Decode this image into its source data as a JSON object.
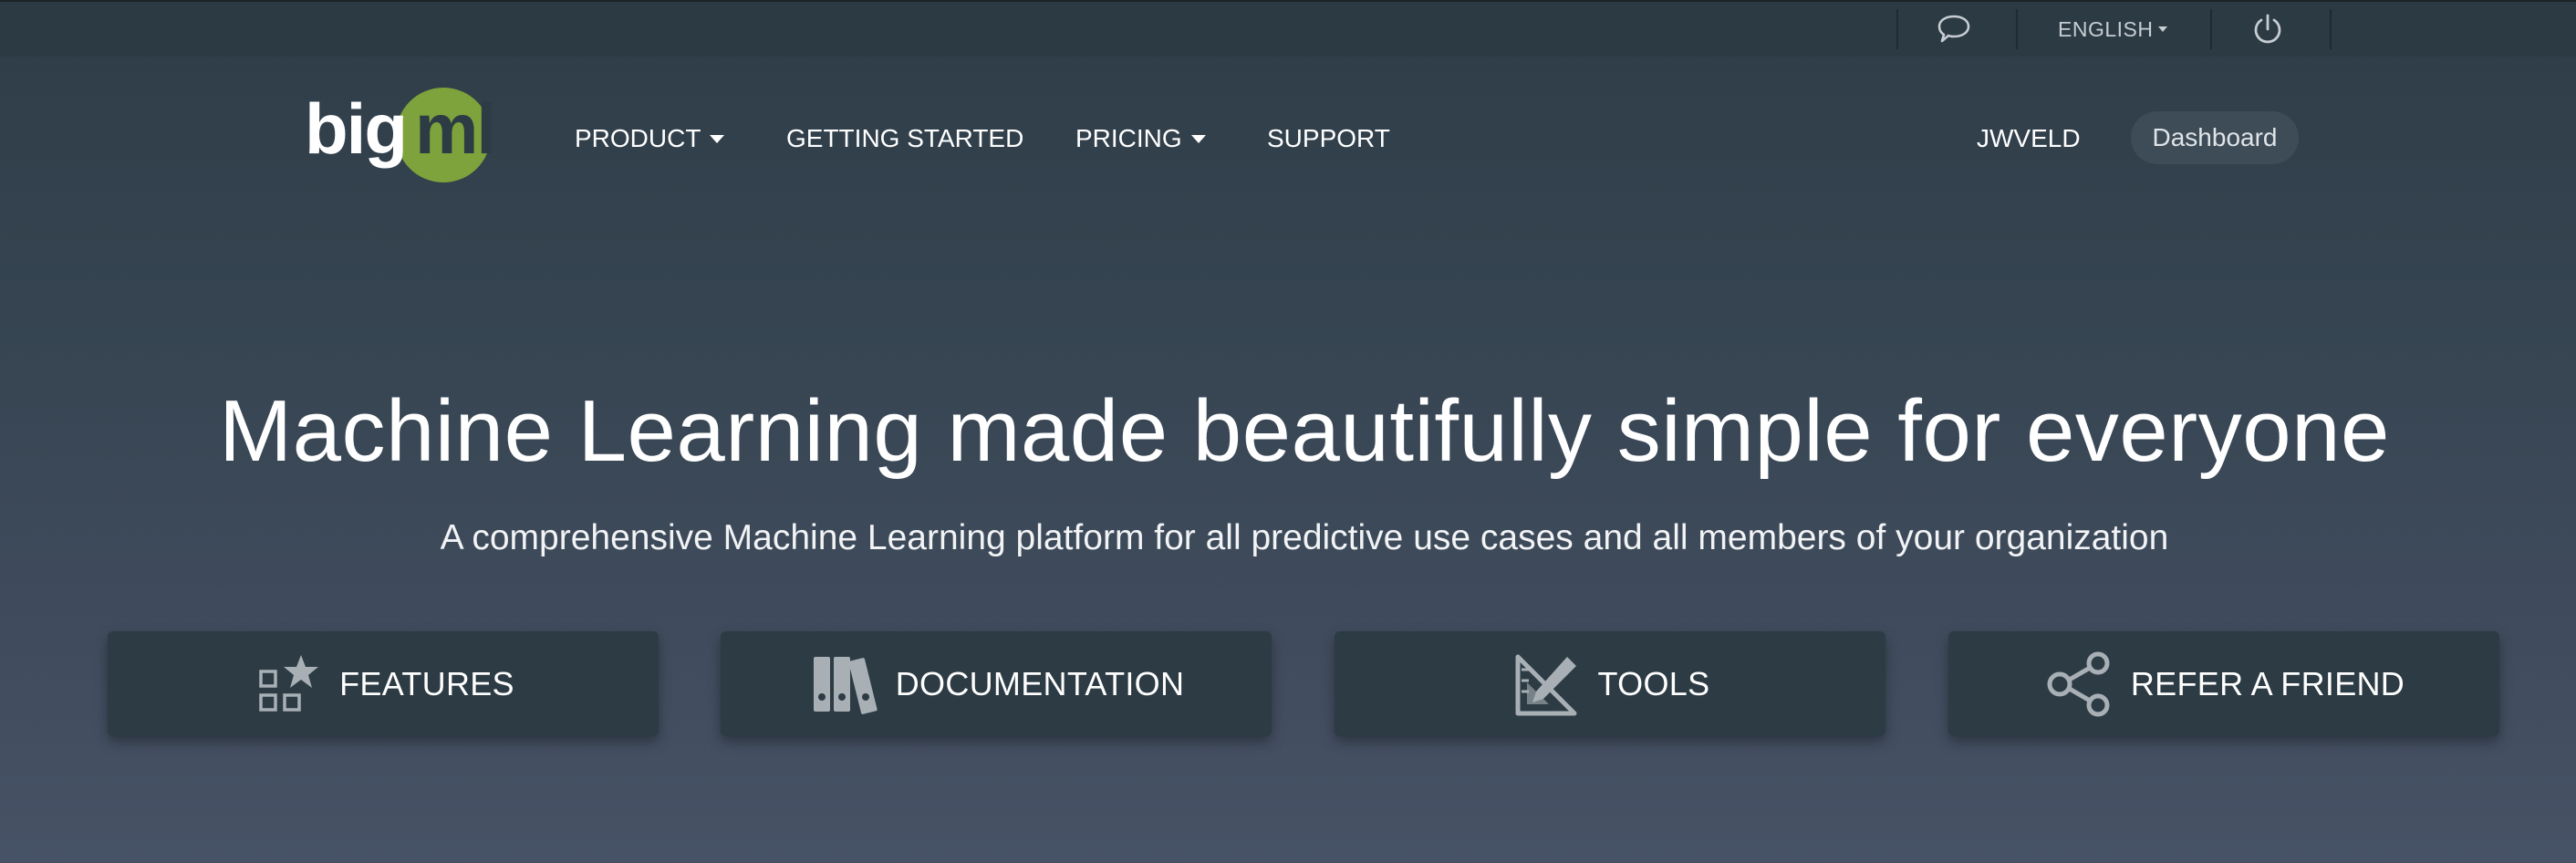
{
  "utility_bar": {
    "language_label": "ENGLISH",
    "icons": [
      "chat-icon",
      "power-icon"
    ]
  },
  "brand": {
    "logo_text_left": "big",
    "logo_text_right": "ml",
    "logo_color": "#7ea23c"
  },
  "nav": {
    "items": [
      {
        "label": "PRODUCT",
        "has_dropdown": true
      },
      {
        "label": "GETTING STARTED",
        "has_dropdown": false
      },
      {
        "label": "PRICING",
        "has_dropdown": true
      },
      {
        "label": "SUPPORT",
        "has_dropdown": false
      }
    ],
    "username": "JWVELD",
    "dashboard_label": "Dashboard"
  },
  "hero": {
    "title": "Machine Learning made beautifully simple for everyone",
    "subtitle": "A comprehensive Machine Learning platform for all predictive use cases and all members of your organization"
  },
  "cards": [
    {
      "label": "FEATURES",
      "icon": "features-icon"
    },
    {
      "label": "DOCUMENTATION",
      "icon": "documentation-icon"
    },
    {
      "label": "TOOLS",
      "icon": "tools-icon"
    },
    {
      "label": "REFER A FRIEND",
      "icon": "share-icon"
    }
  ],
  "colors": {
    "accent_green": "#7ea23c",
    "card_bg": "#2d3b44",
    "icon_gray": "#a8b0b6"
  }
}
